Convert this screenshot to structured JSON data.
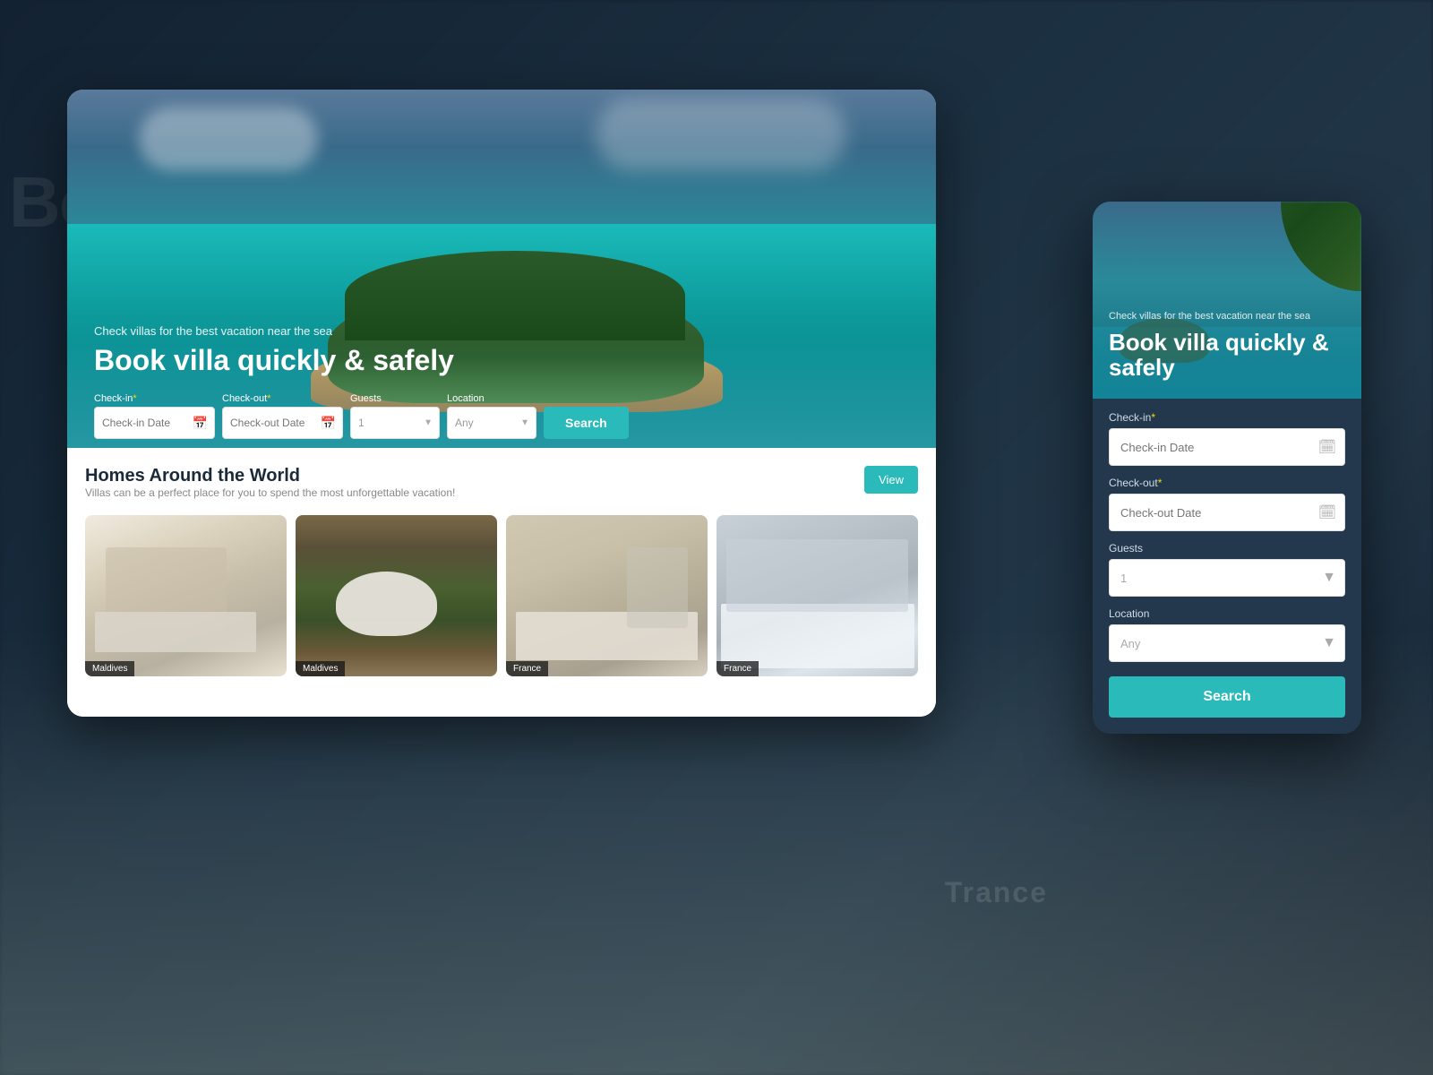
{
  "background": {
    "overlay_color": "rgba(15,25,40,0.55)"
  },
  "desktop_card": {
    "hero": {
      "subtitle": "Check villas for the best vacation near the sea",
      "title": "Book villa quickly & safely"
    },
    "search_bar": {
      "checkin_label": "Check-in",
      "checkin_placeholder": "Check-in Date",
      "checkout_label": "Check-out",
      "checkout_placeholder": "Check-out Date",
      "guests_label": "Guests",
      "guests_value": "1",
      "location_label": "Location",
      "location_value": "Any",
      "search_btn": "Search",
      "required_marker": "*",
      "location_options": [
        "Any",
        "Maldives",
        "France",
        "Trance"
      ]
    },
    "homes_section": {
      "title": "Homes Around the World",
      "subtitle": "Villas can be a perfect place for you to spend the most unforgettable vacation!",
      "view_btn": "View",
      "properties": [
        {
          "label": "Maldives",
          "room_type": "bathroom"
        },
        {
          "label": "Maldives",
          "room_type": "outdoor-bath"
        },
        {
          "label": "France",
          "room_type": "living"
        },
        {
          "label": "France",
          "room_type": "lounge"
        }
      ]
    }
  },
  "mobile_card": {
    "hero": {
      "subtitle": "Check villas for the best vacation near the sea",
      "title": "Book villa quickly & safely"
    },
    "form": {
      "checkin_label": "Check-in",
      "checkin_required": "*",
      "checkin_placeholder": "Check-in Date",
      "checkout_label": "Check-out",
      "checkout_required": "*",
      "checkout_placeholder": "Check-out Date",
      "guests_label": "Guests",
      "guests_value": "1",
      "location_label": "Location",
      "location_value": "Any",
      "search_btn": "Search",
      "location_options": [
        "Any",
        "Maldives",
        "France",
        "Trance"
      ]
    }
  },
  "detected": {
    "trance_text": "Trance",
    "search_text": "Search"
  }
}
